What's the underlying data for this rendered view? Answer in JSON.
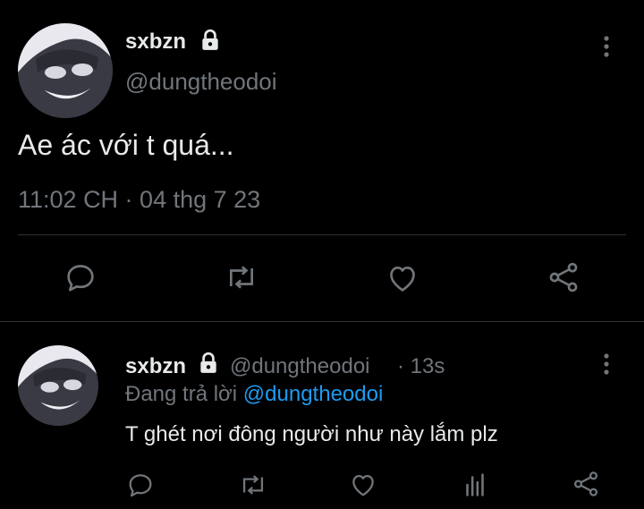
{
  "main_tweet": {
    "display_name": "sxbzn",
    "handle": "@dungtheodoi",
    "text": "Ae ác với t quá...",
    "timestamp": "11:02 CH · 04 thg 7 23",
    "actions": [
      "reply-icon",
      "retweet-icon",
      "like-icon",
      "share-icon"
    ]
  },
  "reply_tweet": {
    "display_name": "sxbzn",
    "handle": "@dungtheodoi",
    "age": "· 13s",
    "replying_prefix": "Đang trả lời",
    "replying_to": "@dungtheodoi",
    "text": "T ghét nơi đông người như này lắm plz",
    "actions": [
      "reply-icon",
      "retweet-icon",
      "like-icon",
      "views-icon",
      "share-icon"
    ]
  },
  "colors": {
    "background": "#000000",
    "text": "#e7e9ea",
    "muted": "#71767b",
    "link": "#1d9bf0",
    "divider": "#2f3336"
  }
}
